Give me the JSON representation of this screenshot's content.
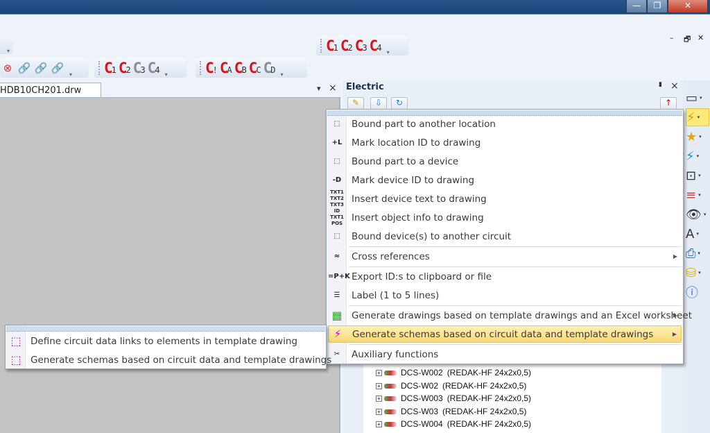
{
  "window": {
    "minimize": "—",
    "restore": "❐",
    "close": "✕"
  },
  "mdi": {
    "minimize": "–",
    "restore": "🗗",
    "close": "✕"
  },
  "toolbars": {
    "circuit_top": [
      {
        "c": "C",
        "n": "1",
        "color": "red"
      },
      {
        "c": "C",
        "n": "2",
        "color": "red"
      },
      {
        "c": "C",
        "n": "3",
        "color": "red"
      },
      {
        "c": "C",
        "n": "4",
        "color": "red"
      }
    ],
    "circuit_row": [
      {
        "c": "C",
        "n": "1",
        "color": "red"
      },
      {
        "c": "C",
        "n": "2",
        "color": "red"
      },
      {
        "c": "C",
        "n": "3",
        "color": "gray"
      },
      {
        "c": "C",
        "n": "4",
        "color": "gray"
      }
    ],
    "circuit_letters": [
      {
        "c": "C",
        "n": "!",
        "color": "red"
      },
      {
        "c": "C",
        "n": "A",
        "color": "red"
      },
      {
        "c": "C",
        "n": "B",
        "color": "red"
      },
      {
        "c": "C",
        "n": "C",
        "color": "red"
      },
      {
        "c": "C",
        "n": "D",
        "color": "gray"
      }
    ]
  },
  "document": {
    "tab_label": "HDB10CH201.drw",
    "pane_menu": "▾",
    "pane_close": "×"
  },
  "panel": {
    "title": "Electric",
    "pin": "📌",
    "close": "×"
  },
  "tree": [
    {
      "id": "DCS-W002",
      "type": "(REDAK-HF 24x2x0,5)"
    },
    {
      "id": "DCS-W02",
      "type": "(REDAK-HF 24x2x0,5)"
    },
    {
      "id": "DCS-W003",
      "type": "(REDAK-HF 24x2x0,5)"
    },
    {
      "id": "DCS-W03",
      "type": "(REDAK-HF 24x2x0,5)"
    },
    {
      "id": "DCS-W004",
      "type": "(REDAK-HF 24x2x0,5)"
    }
  ],
  "menu": {
    "items": [
      {
        "label": "Bound part to another location",
        "icon": "bound-location-icon",
        "glyph": "⬚"
      },
      {
        "label": "Mark location ID to drawing",
        "icon": "mark-location-icon",
        "glyph": "+L"
      },
      {
        "label": "Bound part to a device",
        "icon": "bound-device-icon",
        "glyph": "⬚"
      },
      {
        "label": "Mark device ID to drawing",
        "icon": "mark-device-icon",
        "glyph": "-D"
      },
      {
        "label": "Insert device text to drawing",
        "icon": "device-text-icon",
        "glyph": "TXT1 TXT2 TXT3"
      },
      {
        "label": "Insert object info to drawing",
        "icon": "object-info-icon",
        "glyph": "ID TXT1 POS"
      },
      {
        "label": "Bound device(s) to another circuit",
        "icon": "bound-circuit-icon",
        "glyph": "⬚"
      },
      {
        "label": "Cross references",
        "icon": "cross-references-icon",
        "glyph": "≈",
        "submenu": true
      },
      {
        "label": "Export ID:s to clipboard or file",
        "icon": "export-ids-icon",
        "glyph": "=P+K"
      },
      {
        "label": "Label (1 to 5 lines)",
        "icon": "label-icon",
        "glyph": "☰"
      },
      {
        "label": "Generate drawings based on template drawings and an Excel worksheet",
        "icon": "excel-generate-icon",
        "glyph": "▦",
        "submenu": true
      },
      {
        "label": "Generate schemas based on circuit data and template drawings",
        "icon": "schema-generate-icon",
        "glyph": "⚡",
        "submenu": true,
        "highlighted": true
      },
      {
        "label": "Auxiliary functions",
        "icon": "tools-icon",
        "glyph": "✂"
      }
    ]
  },
  "submenu": {
    "items": [
      {
        "label": "Define circuit data links to elements in template drawing",
        "icon": "define-links-icon"
      },
      {
        "label": "Generate schemas based on circuit data and template drawings",
        "icon": "generate-schemas-icon"
      }
    ]
  },
  "colors": {
    "accent_red": "#e0101a",
    "highlight": "#f8d873",
    "titlebar": "#1b4478"
  }
}
